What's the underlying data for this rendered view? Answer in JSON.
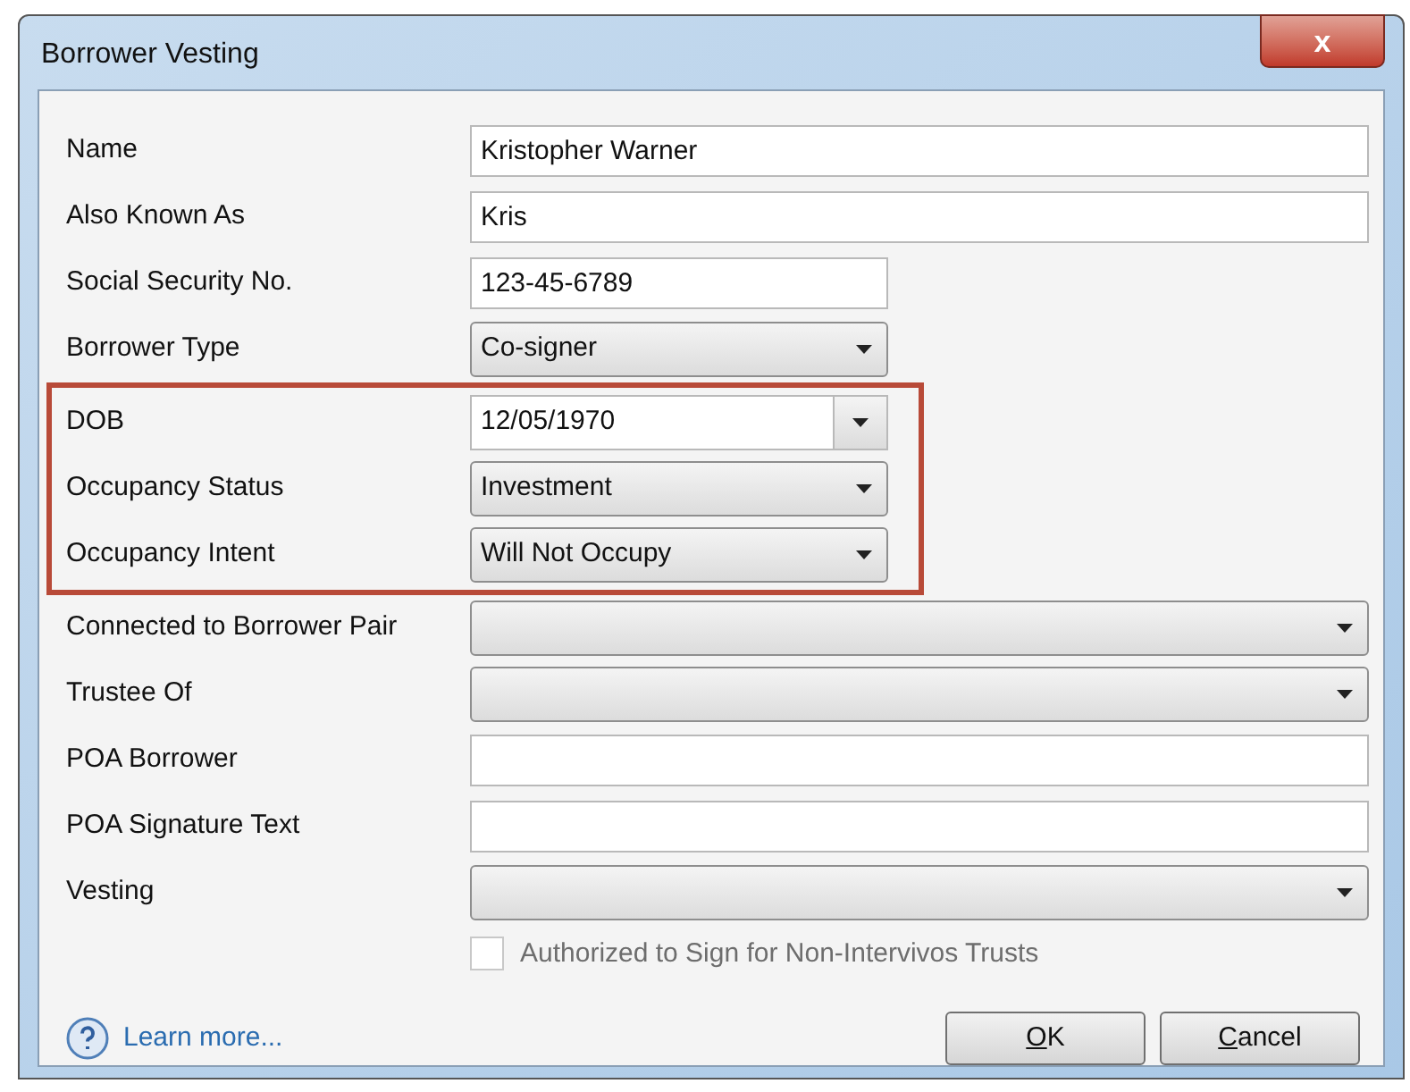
{
  "window": {
    "title": "Borrower Vesting",
    "close": "x"
  },
  "fields": [
    {
      "label": "Name",
      "kind": "text",
      "value": "Kristopher Warner",
      "wide": true,
      "highlighted": false
    },
    {
      "label": "Also Known As",
      "kind": "text",
      "value": "Kris",
      "wide": true,
      "highlighted": false
    },
    {
      "label": "Social Security No.",
      "kind": "text",
      "value": "123-45-6789",
      "wide": false,
      "highlighted": false
    },
    {
      "label": "Borrower Type",
      "kind": "combo",
      "value": "Co-signer",
      "wide": false,
      "highlighted": false
    },
    {
      "label": "DOB",
      "kind": "date",
      "value": "12/05/1970",
      "wide": false,
      "highlighted": true
    },
    {
      "label": "Occupancy Status",
      "kind": "combo",
      "value": "Investment",
      "wide": false,
      "highlighted": true
    },
    {
      "label": "Occupancy Intent",
      "kind": "combo",
      "value": "Will Not Occupy",
      "wide": false,
      "highlighted": true
    },
    {
      "label": "Connected to Borrower Pair",
      "kind": "combo",
      "wide": true,
      "highlighted": false
    },
    {
      "label": "Trustee Of",
      "kind": "combo",
      "wide": true,
      "highlighted": false
    },
    {
      "label": "POA Borrower",
      "kind": "text",
      "wide": true,
      "highlighted": false
    },
    {
      "label": "POA Signature Text",
      "kind": "text",
      "wide": true,
      "highlighted": false
    },
    {
      "label": "Vesting",
      "kind": "combo",
      "wide": true,
      "highlighted": false
    }
  ],
  "checkbox": {
    "label": "Authorized to Sign for Non-Intervivos Trusts",
    "checked": false,
    "disabled": true
  },
  "help_link": "Learn more...",
  "buttons": [
    {
      "label": "OK",
      "underline_first": true
    },
    {
      "label": "Cancel",
      "underline_first": true
    }
  ]
}
